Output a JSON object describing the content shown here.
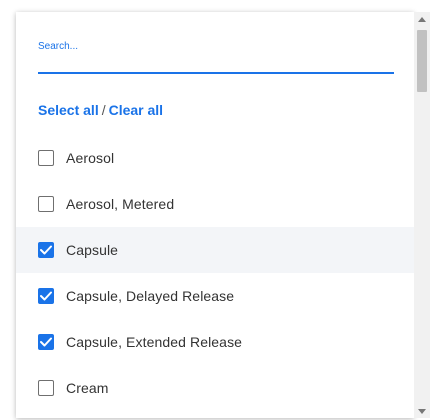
{
  "search": {
    "placeholder": "Search...",
    "value": ""
  },
  "selection": {
    "select_all": "Select all",
    "separator": "/",
    "clear_all": "Clear all"
  },
  "options": [
    {
      "label": "Aerosol",
      "checked": false
    },
    {
      "label": "Aerosol, Metered",
      "checked": false
    },
    {
      "label": "Capsule",
      "checked": true
    },
    {
      "label": "Capsule, Delayed Release",
      "checked": true
    },
    {
      "label": "Capsule, Extended Release",
      "checked": true
    },
    {
      "label": "Cream",
      "checked": false
    }
  ],
  "colors": {
    "accent": "#1a73e8",
    "checkbox_border": "#6f6f6f",
    "text": "#333333",
    "hover_row": "#f3f5f8"
  },
  "icons": {
    "checkmark": "check-icon",
    "scroll_up": "arrow-up-icon",
    "scroll_down": "arrow-down-icon"
  }
}
